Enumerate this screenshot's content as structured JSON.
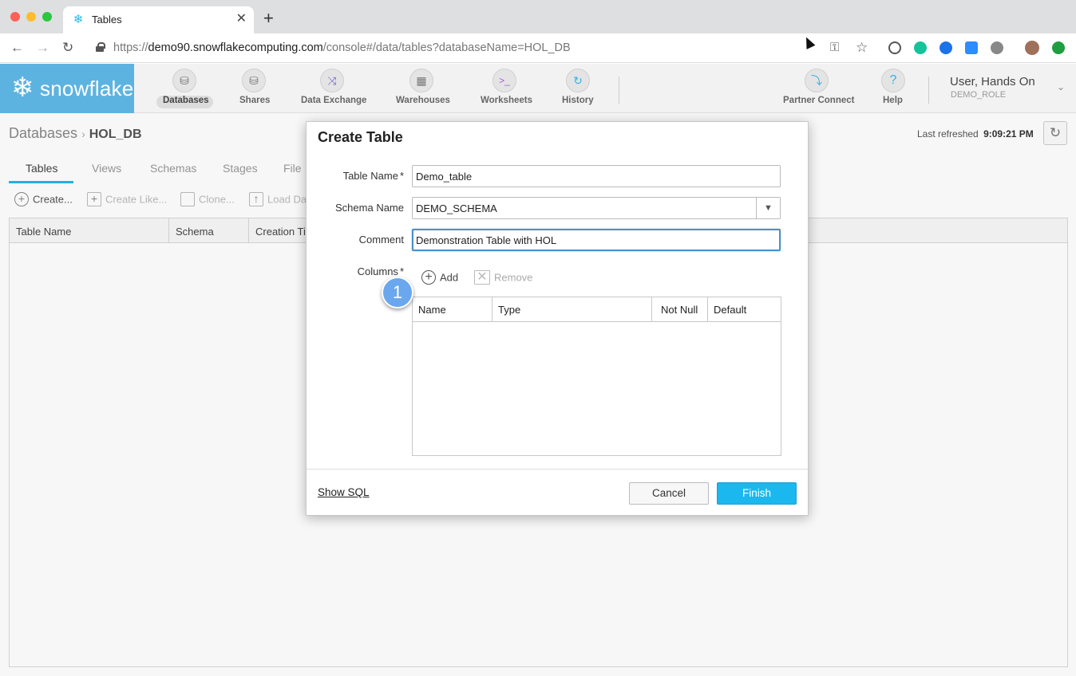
{
  "browser": {
    "tab_title": "Tables",
    "url_scheme": "https://",
    "url_host": "demo90.snowflakecomputing.com",
    "url_path": "/console#/data/tables?databaseName=HOL_DB"
  },
  "app": {
    "logo_text": "snowflake",
    "nav": [
      {
        "label": "Databases",
        "icon": "database-icon"
      },
      {
        "label": "Shares",
        "icon": "share-icon"
      },
      {
        "label": "Data Exchange",
        "icon": "shuffle-icon"
      },
      {
        "label": "Warehouses",
        "icon": "grid-icon"
      },
      {
        "label": "Worksheets",
        "icon": "terminal-icon"
      },
      {
        "label": "History",
        "icon": "refresh-icon"
      }
    ],
    "partner_connect": "Partner Connect",
    "help": "Help",
    "user_name": "User, Hands On",
    "user_role": "DEMO_ROLE"
  },
  "page": {
    "breadcrumb_root": "Databases",
    "breadcrumb_db": "HOL_DB",
    "last_refreshed_label": "Last refreshed",
    "last_refreshed_time": "9:09:21 PM",
    "tabs": [
      "Tables",
      "Views",
      "Schemas",
      "Stages",
      "File"
    ],
    "toolbar": [
      "Create...",
      "Create Like...",
      "Clone...",
      "Load Da"
    ],
    "columns": [
      "Table Name",
      "Schema",
      "Creation Ti"
    ]
  },
  "dialog": {
    "title": "Create Table",
    "table_name_label": "Table Name",
    "table_name_value": "Demo_table",
    "schema_name_label": "Schema Name",
    "schema_name_value": "DEMO_SCHEMA",
    "comment_label": "Comment",
    "comment_value": "Demonstration Table with HOL",
    "columns_label": "Columns",
    "required_mark": "*",
    "add_label": "Add",
    "remove_label": "Remove",
    "step_number": "1",
    "column_headers": [
      "Name",
      "Type",
      "Not Null",
      "Default"
    ],
    "show_sql": "Show SQL",
    "cancel": "Cancel",
    "finish": "Finish"
  },
  "colors": {
    "accent": "#29b5e8",
    "finish_button": "#1ab8ee",
    "logo_bg": "#5db3e0",
    "step_badge": "#6aa7ee"
  }
}
